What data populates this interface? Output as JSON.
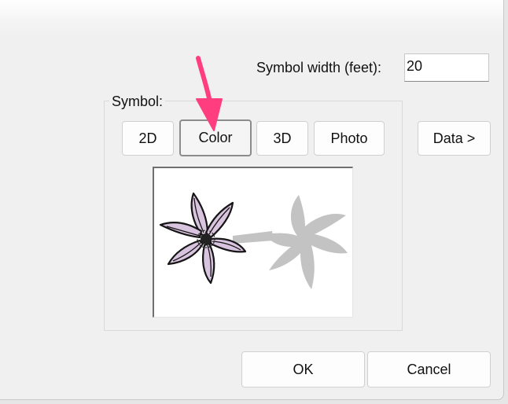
{
  "symbol_width": {
    "label": "Symbol width (feet):",
    "value": "20"
  },
  "symbol_group": {
    "label": "Symbol:",
    "buttons": [
      {
        "label": "2D"
      },
      {
        "label": "Color"
      },
      {
        "label": "3D"
      },
      {
        "label": "Photo"
      }
    ],
    "selected": "Color"
  },
  "data_button": {
    "label": "Data >"
  },
  "footer": {
    "ok_label": "OK",
    "cancel_label": "Cancel"
  },
  "colors": {
    "annotation_arrow": "#ff3d7f",
    "flower_fill": "#d8c4de",
    "shadow_fill": "#c3c3c3"
  },
  "icons": {
    "preview_symbol": "flower-plant-icon",
    "annotation": "pink-arrow-icon"
  }
}
